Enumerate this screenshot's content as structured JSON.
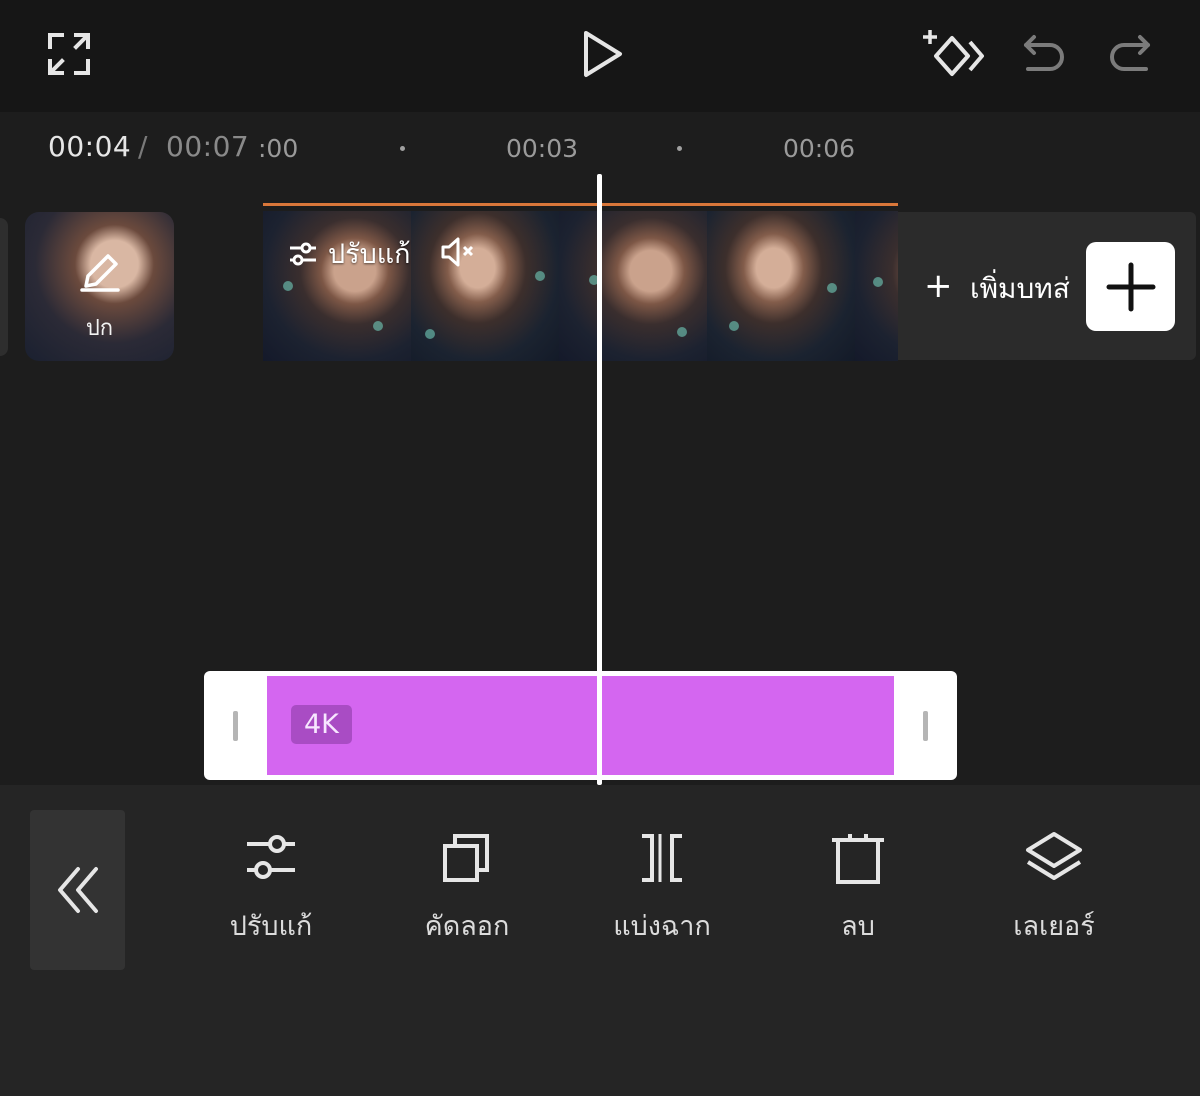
{
  "top_bar": {
    "fullscreen_icon": "fullscreen-icon",
    "play_icon": "play-icon",
    "keyframe_icon": "keyframe-add-icon",
    "undo_icon": "undo-icon",
    "redo_icon": "redo-icon"
  },
  "timeline": {
    "current_time": "00:04",
    "separator": "/",
    "total_time": "00:07",
    "ticks": [
      ":00",
      "00:03",
      "00:06"
    ],
    "cover_label": "ปก",
    "clip_adjust_label": "ปรับแก้",
    "add_ending_label": "เพิ่มบทส่",
    "add_ending_plus": "+",
    "overlay_badge": "4K"
  },
  "toolbar": {
    "tools": [
      {
        "label": "ปรับแก้",
        "icon": "adjust-sliders-icon"
      },
      {
        "label": "คัดลอก",
        "icon": "copy-icon"
      },
      {
        "label": "แบ่งฉาก",
        "icon": "split-icon"
      },
      {
        "label": "ลบ",
        "icon": "delete-icon"
      },
      {
        "label": "เลเยอร์",
        "icon": "layers-icon"
      }
    ]
  },
  "colors": {
    "accent_orange": "#d9773a",
    "overlay_clip": "#d466f0",
    "badge": "#a94cc4"
  }
}
